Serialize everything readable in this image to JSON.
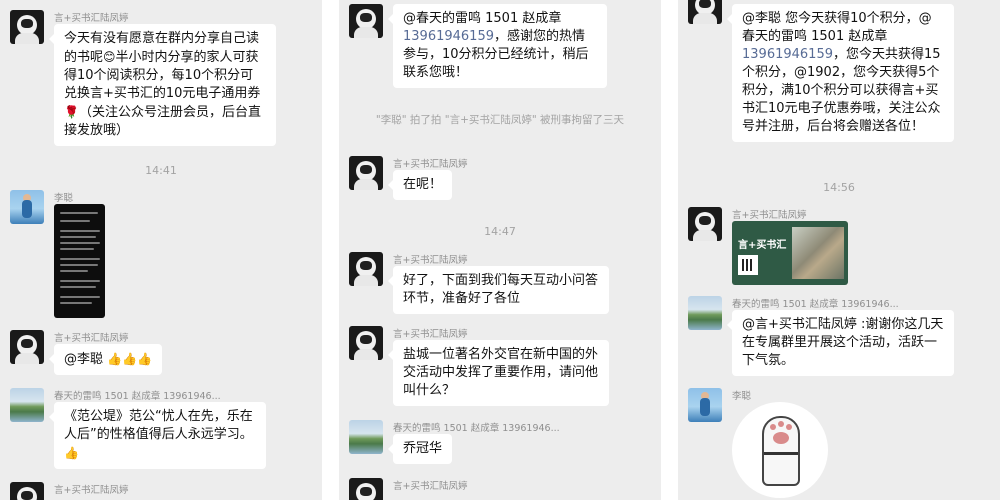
{
  "p1": {
    "m1": {
      "sender": "言+买书汇陆凤婷",
      "t1": "今天有没有愿意在群内分享自己读的书呢",
      "emoji1": "😊",
      "t2": "半小时内分享的家人可获得10个阅读积分，每10个积分可兑换言+买书汇的10元电子通用券",
      "emoji2": "🌹",
      "t3": "（关注公众号注册会员，后台直接发放哦）"
    },
    "time1": "14:41",
    "m2": {
      "sender": "李聪"
    },
    "m3": {
      "sender": "言+买书汇陆凤婷",
      "text": "@李聪 ",
      "emoji": "👍👍👍"
    },
    "m4": {
      "sender": "春天的雷鸣 1501 赵成章 13961946...",
      "text": "《范公堤》范公“忧人在先，乐在人后”的性格值得后人永远学习。",
      "emoji": "👍"
    },
    "m5": {
      "sender": "言+买书汇陆凤婷"
    }
  },
  "p2": {
    "m1": {
      "t1": "@春天的雷鸣 1501 赵成章 ",
      "phone": "13961946159",
      "t2": "，感谢您的热情参与，10分积分已经统计，稍后联系您哦！"
    },
    "sys1": "\"李聪\" 拍了拍 \"言+买书汇陆凤婷\" 被刑事拘留了三天",
    "m2": {
      "sender": "言+买书汇陆凤婷",
      "text": "在呢！"
    },
    "time1": "14:47",
    "m3": {
      "sender": "言+买书汇陆凤婷",
      "text": "好了，下面到我们每天互动小问答环节，准备好了各位"
    },
    "m4": {
      "sender": "言+买书汇陆凤婷",
      "text": "盐城一位著名外交官在新中国的外交活动中发挥了重要作用，请问他叫什么？"
    },
    "m5": {
      "sender": "春天的雷鸣 1501 赵成章 13961946...",
      "text": "乔冠华"
    },
    "m6": {
      "sender": "言+买书汇陆凤婷"
    }
  },
  "p3": {
    "m1": {
      "t1": "@李聪 您今天获得10个积分，@春天的雷鸣 1501 赵成章 ",
      "phone": "13961946159",
      "t2": "，您今天共获得15个积分，@1902，您今天获得5个积分，满10个积分可以获得言+买书汇10元电子优惠券哦，关注公众号并注册，后台将会赠送各位！"
    },
    "time1": "14:56",
    "m2": {
      "sender": "言+买书汇陆凤婷",
      "card_title": "言+买书汇"
    },
    "m3": {
      "sender": "春天的雷鸣 1501 赵成章 13961946...",
      "text": "@言+买书汇陆凤婷 :谢谢你这几天在专属群里开展这个活动，活跃一下气氛。"
    },
    "m4": {
      "sender": "李聪"
    }
  },
  "colors": {
    "chat_bg": "#ededed",
    "bubble": "#ffffff",
    "link": "#576b95",
    "meta": "#8f8f8f"
  }
}
